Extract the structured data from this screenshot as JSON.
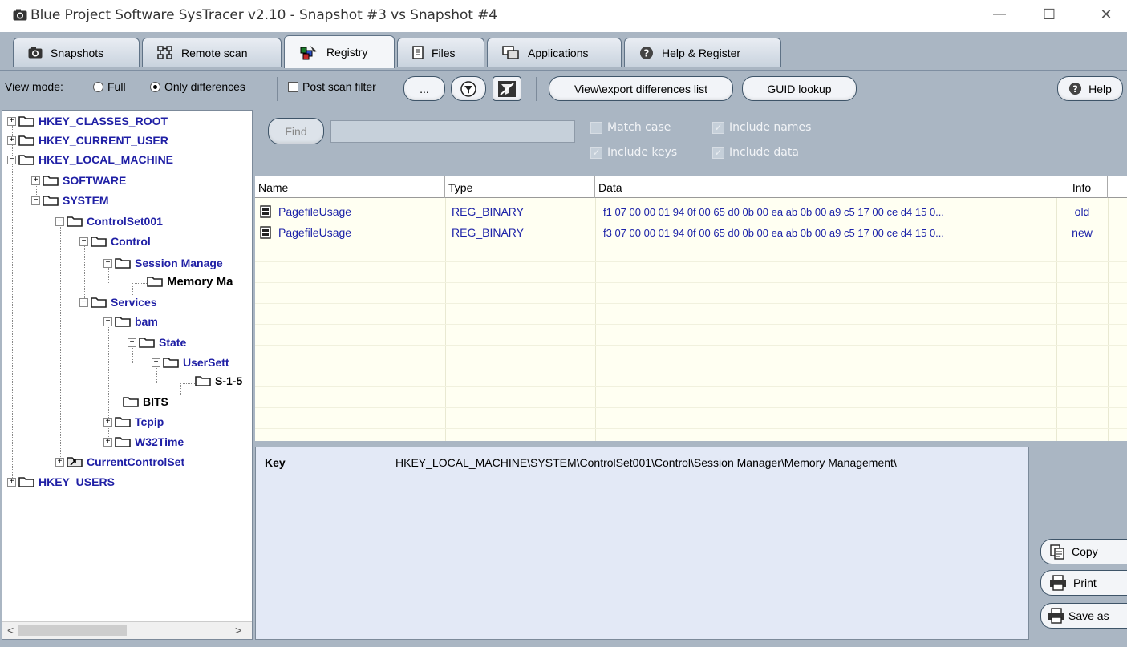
{
  "window": {
    "title": "Blue Project Software SysTracer v2.10 - Snapshot #3 vs Snapshot #4",
    "minimize": "—",
    "maximize": "☐",
    "close": "✕"
  },
  "tabs": [
    {
      "label": "Snapshots",
      "icon": "camera-icon"
    },
    {
      "label": "Remote scan",
      "icon": "network-icon"
    },
    {
      "label": "Registry",
      "icon": "registry-icon",
      "active": true
    },
    {
      "label": "Files",
      "icon": "file-icon"
    },
    {
      "label": "Applications",
      "icon": "applications-icon"
    },
    {
      "label": "Help & Register",
      "icon": "help-icon"
    }
  ],
  "toolbar": {
    "view_mode_label": "View mode:",
    "full_label": "Full",
    "only_diff_label": "Only differences",
    "view_mode_selected": "Only differences",
    "post_scan_filter_label": "Post scan filter",
    "post_scan_filter_checked": false,
    "ellipsis_label": "...",
    "export_label": "View\\export differences list",
    "guid_label": "GUID lookup",
    "help_label": "Help"
  },
  "tree": [
    {
      "label": "HKEY_CLASSES_ROOT",
      "expander": "+"
    },
    {
      "label": "HKEY_CURRENT_USER",
      "expander": "+"
    },
    {
      "label": "HKEY_LOCAL_MACHINE",
      "expander": "−"
    },
    {
      "label": "SOFTWARE",
      "expander": "+"
    },
    {
      "label": "SYSTEM",
      "expander": "−"
    },
    {
      "label": "ControlSet001",
      "expander": "−"
    },
    {
      "label": "Control",
      "expander": "−"
    },
    {
      "label": "Session Manage",
      "expander": "−"
    },
    {
      "label": "Memory Ma",
      "expander": "",
      "selected": true
    },
    {
      "label": "Services",
      "expander": "−"
    },
    {
      "label": "bam",
      "expander": "−"
    },
    {
      "label": "State",
      "expander": "−"
    },
    {
      "label": "UserSett",
      "expander": "−"
    },
    {
      "label": "S-1-5",
      "expander": ""
    },
    {
      "label": "BITS",
      "expander": ""
    },
    {
      "label": "Tcpip",
      "expander": "+"
    },
    {
      "label": "W32Time",
      "expander": "+"
    },
    {
      "label": "CurrentControlSet",
      "expander": "+"
    },
    {
      "label": "HKEY_USERS",
      "expander": "+"
    }
  ],
  "find": {
    "button_label": "Find",
    "input_value": "",
    "match_case_label": "Match case",
    "match_case_checked": false,
    "include_names_label": "Include names",
    "include_names_checked": true,
    "include_keys_label": "Include keys",
    "include_keys_checked": true,
    "include_data_label": "Include data",
    "include_data_checked": true
  },
  "grid": {
    "columns": [
      "Name",
      "Type",
      "Data",
      "Info"
    ],
    "rows": [
      {
        "name": "PagefileUsage",
        "type": "REG_BINARY",
        "data": "f1 07 00 00 01 94 0f 00 65 d0 0b 00 ea ab 0b 00 a9 c5 17 00 ce d4 15 0...",
        "info": "old"
      },
      {
        "name": "PagefileUsage",
        "type": "REG_BINARY",
        "data": "f3 07 00 00 01 94 0f 00 65 d0 0b 00 ea ab 0b 00 a9 c5 17 00 ce d4 15 0...",
        "info": "new"
      }
    ]
  },
  "details": {
    "key_label": "Key",
    "key_value": "HKEY_LOCAL_MACHINE\\SYSTEM\\ControlSet001\\Control\\Session Manager\\Memory Management\\"
  },
  "side_buttons": {
    "copy_label": "Copy",
    "print_label": "Print",
    "save_label": "Save as"
  },
  "scroll": {
    "left_arrow": "<",
    "right_arrow": ">"
  },
  "colors": {
    "chrome": "#aab6c3",
    "link_blue": "#1c22a8",
    "grid_bg": "#fffff2",
    "details_bg": "#e3e9f6"
  }
}
